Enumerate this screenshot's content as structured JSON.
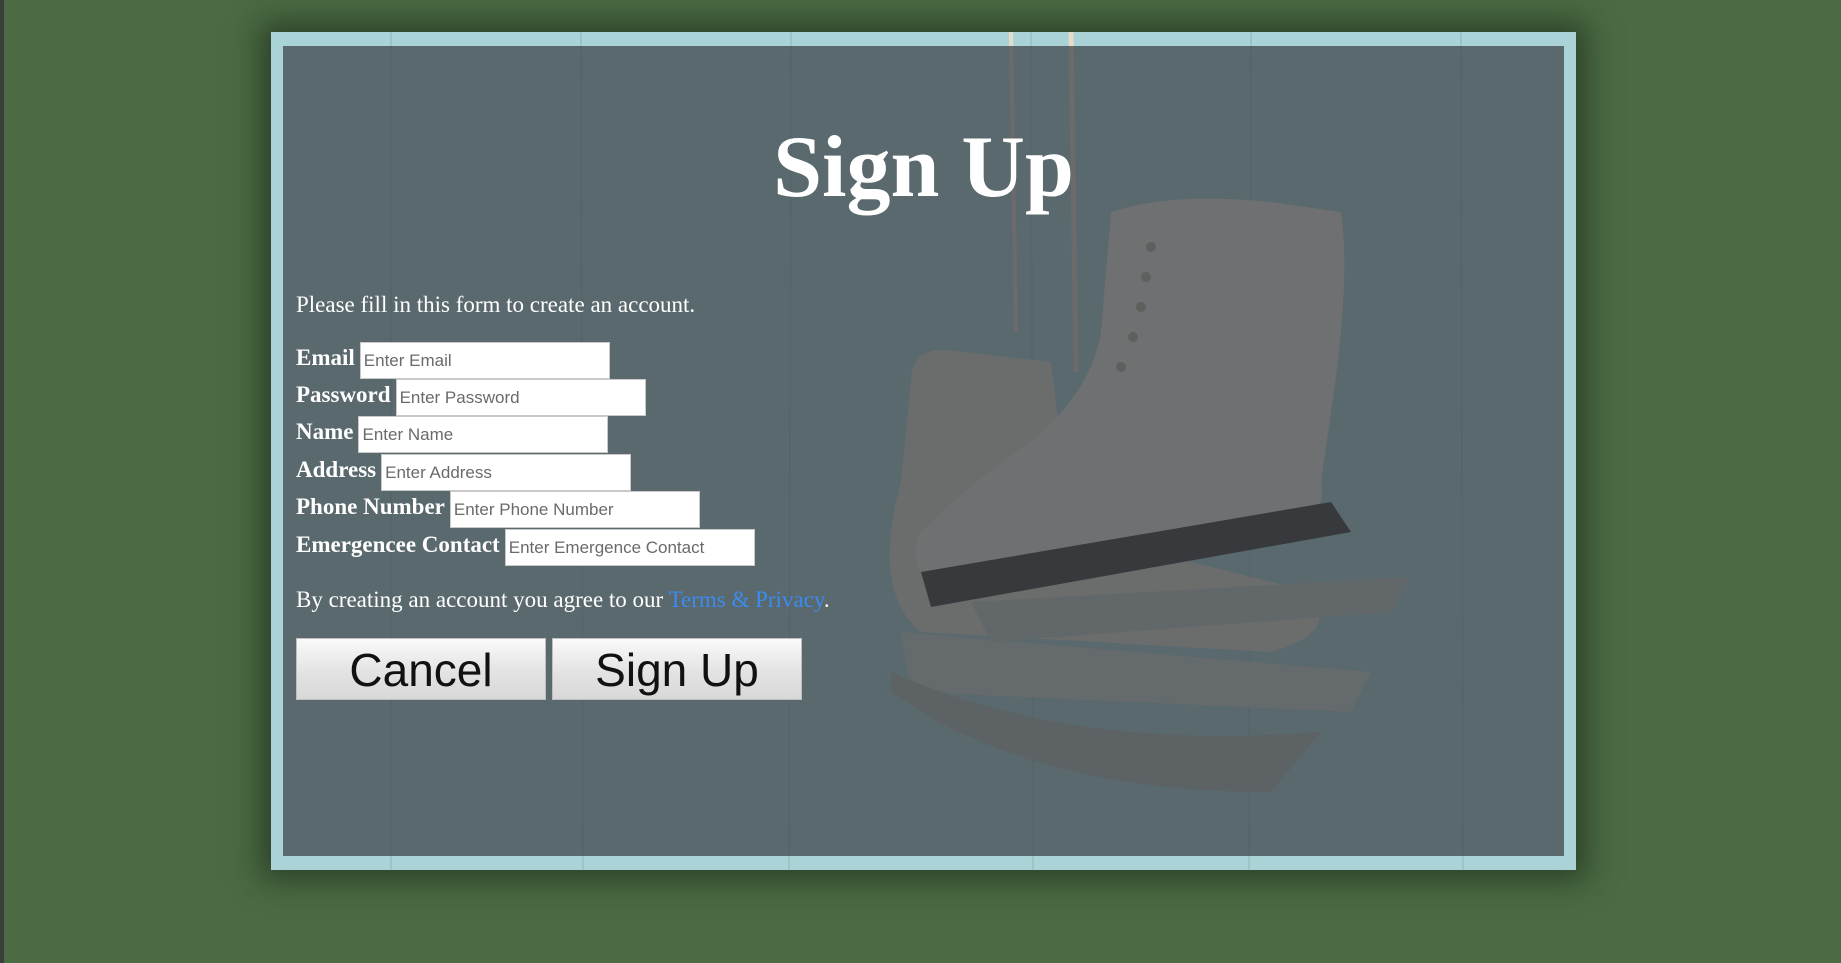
{
  "modal": {
    "title": "Sign Up",
    "intro": "Please fill in this form to create an account."
  },
  "form": {
    "fields": [
      {
        "label": "Email",
        "placeholder": "Enter Email"
      },
      {
        "label": "Password",
        "placeholder": "Enter Password"
      },
      {
        "label": "Name",
        "placeholder": "Enter Name"
      },
      {
        "label": "Address",
        "placeholder": "Enter Address"
      },
      {
        "label": "Phone Number",
        "placeholder": "Enter Phone Number"
      },
      {
        "label": "Emergencee Contact",
        "placeholder": "Enter Emergence Contact"
      }
    ]
  },
  "terms": {
    "prefix": "By creating an account you agree to our ",
    "link": "Terms & Privacy",
    "suffix": "."
  },
  "buttons": {
    "cancel": "Cancel",
    "signup": "Sign Up"
  },
  "colors": {
    "page_background": "#4a6b43",
    "link": "#3b8cf0",
    "frame": "#b9dedf"
  }
}
